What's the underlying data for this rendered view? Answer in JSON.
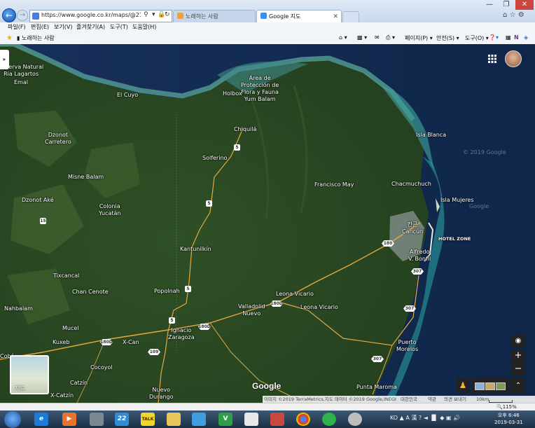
{
  "browser": {
    "address": "https://www.google.co.kr/maps/@21.17700",
    "tabs": [
      {
        "label": "노래하는 사람"
      },
      {
        "label": "Google 지도"
      }
    ],
    "menu": [
      "파일(F)",
      "편집(E)",
      "보기(V)",
      "즐겨찾기(A)",
      "도구(T)",
      "도움말(H)"
    ],
    "favorites": {
      "item": "노래하는 사람"
    },
    "commands": [
      "페이지(P) ▾",
      "안전(S) ▾",
      "도구(O) ▾"
    ]
  },
  "map": {
    "labels": [
      "Reserva Natural",
      "Ria Lagartos",
      "Emal",
      "El Cuyo",
      "Área de",
      "Protección de",
      "Flora y Fauna",
      "Yum Balam",
      "Holbox",
      "Chiquilá",
      "Dzonot",
      "Carretero",
      "Solferino",
      "Isla Blanca",
      "Misne Balam",
      "Francisco May",
      "Chacmuchuch",
      "Dzonot Aké",
      "Colonia",
      "Yucatán",
      "Isla Mujeres",
      "Cancún",
      "칸쿤",
      "HOTEL ZONE",
      "Kantunilkín",
      "Alfredo",
      "V. Bonfil",
      "Tixcancal",
      "Chan Cenote",
      "Popolnah",
      "Leona Vicario",
      "Nahbalam",
      "Valladolid",
      "Nuevo",
      "Leona Vicario",
      "Mucel",
      "Ignacio",
      "Zaragoza",
      "Kuxeb",
      "X-Can",
      "Puerto",
      "Morelos",
      "Cocoyol",
      "Catzín",
      "Nuevo",
      "Durango",
      "Punta Maroma",
      "X-Catzín",
      "Cobá"
    ],
    "route_shields": [
      "5",
      "5",
      "5",
      "5",
      "15",
      "180",
      "180D",
      "180D",
      "180D",
      "307",
      "307",
      "109",
      "307"
    ],
    "layer_label": "지도",
    "logo": "Google",
    "watermark": "© 2019 Google",
    "watermark2": "Google",
    "controls": {
      "locate": "◉",
      "zoom_in": "+",
      "zoom_out": "−",
      "expand": "⌃"
    },
    "attribution": {
      "imagery": "이미지 ©2019 TerraMetrics,지도 데이터 ©2019 Google,INEGI",
      "country": "대한민국",
      "terms": "약관",
      "feedback": "의견 보내기",
      "scale": "10km"
    }
  },
  "statusbar": {
    "zoom": "🔍115%"
  },
  "taskbar": {
    "apps": [
      "e",
      "▶",
      "",
      "22",
      "TALK",
      "",
      "",
      "V",
      "",
      "",
      "",
      "",
      ""
    ],
    "tray": "KO ▲ A 漢 ? ◄ ▐▌ ◆ ▣ 🔊",
    "time": "오후 6:46",
    "date": "2019-03-31"
  }
}
